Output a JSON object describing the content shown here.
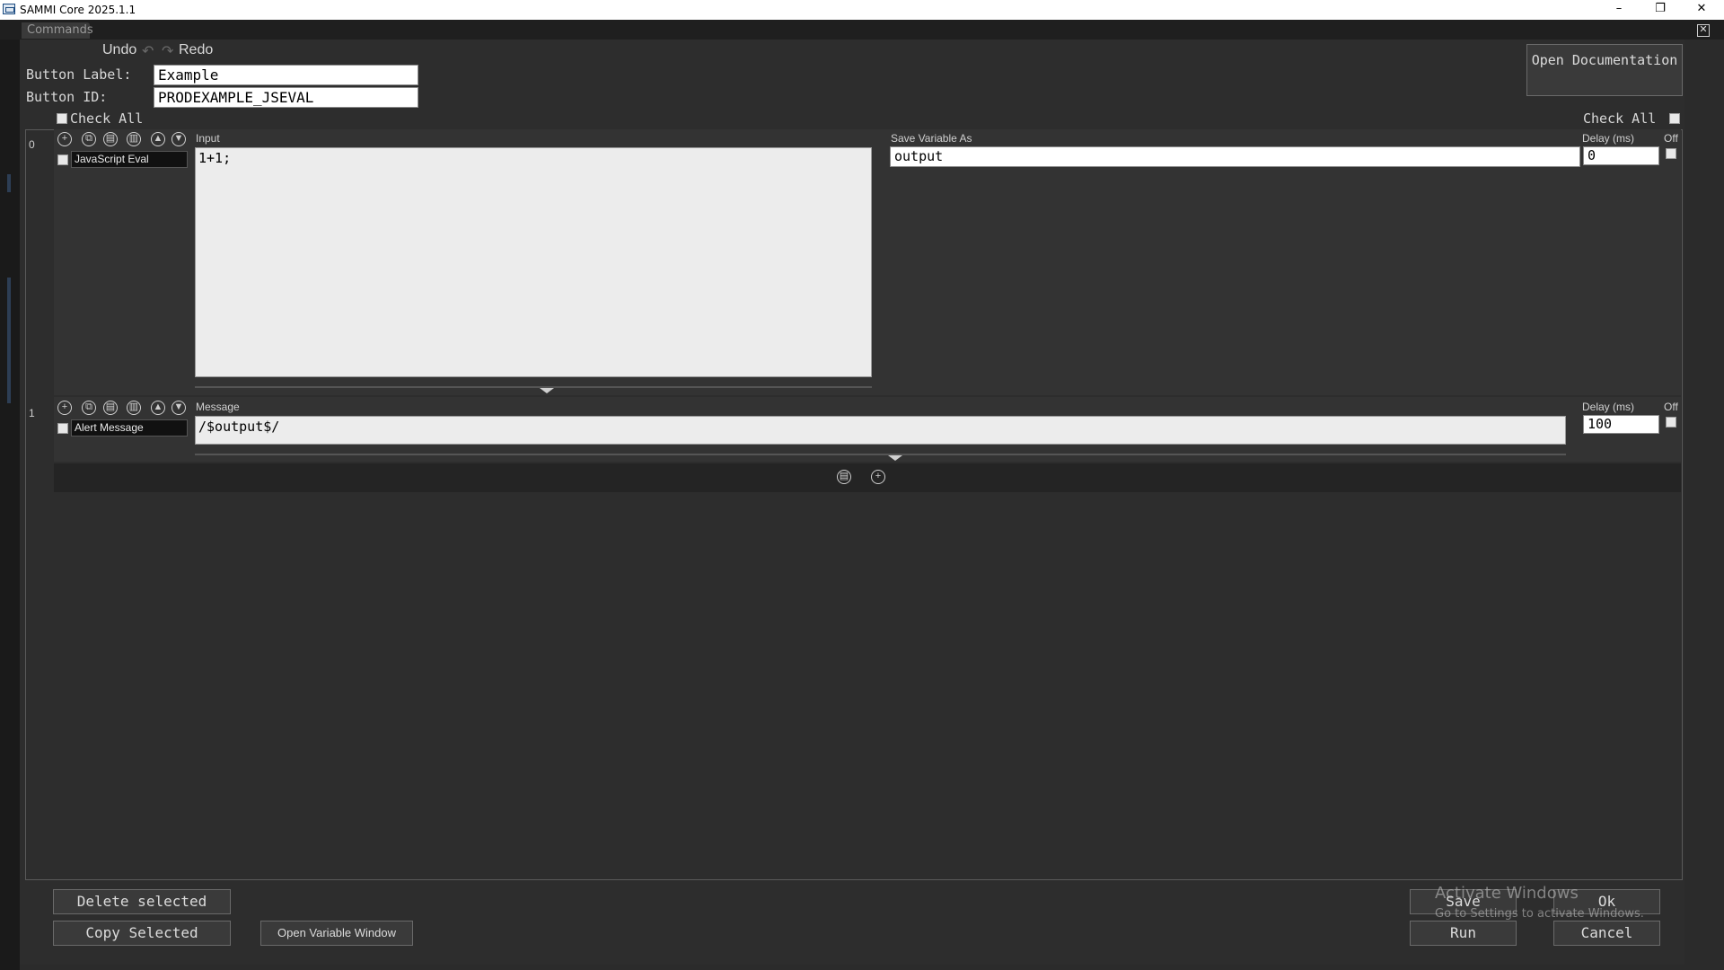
{
  "window": {
    "title": "SAMMI Core 2025.1.1",
    "minimize": "–",
    "restore": "❐",
    "close": "✕"
  },
  "tabs": {
    "commands": "Commands"
  },
  "toolbar": {
    "undo": "Undo",
    "redo": "Redo"
  },
  "header": {
    "button_label_caption": "Button Label:",
    "button_label_value": "Example",
    "button_id_caption": "Button ID:",
    "button_id_value": "PRODEXAMPLE_JSEVAL",
    "check_all_left": "Check All",
    "check_all_right": "Check All",
    "open_documentation": "Open Documentation"
  },
  "commands": [
    {
      "index": "0",
      "name": "JavaScript Eval",
      "input_label": "Input",
      "input_value": "1+1;",
      "save_label": "Save Variable As",
      "save_value": "output",
      "delay_label": "Delay (ms)",
      "delay_value": "0",
      "off_label": "Off"
    },
    {
      "index": "1",
      "name": "Alert Message",
      "message_label": "Message",
      "message_value": "/$output$/",
      "delay_label": "Delay (ms)",
      "delay_value": "100",
      "off_label": "Off"
    }
  ],
  "footer": {
    "delete_selected": "Delete selected",
    "copy_selected": "Copy Selected",
    "open_variable_window": "Open Variable Window",
    "save": "Save",
    "ok": "Ok",
    "run": "Run",
    "cancel": "Cancel"
  },
  "watermark": {
    "line1": "Activate Windows",
    "line2": "Go to Settings to activate Windows."
  }
}
